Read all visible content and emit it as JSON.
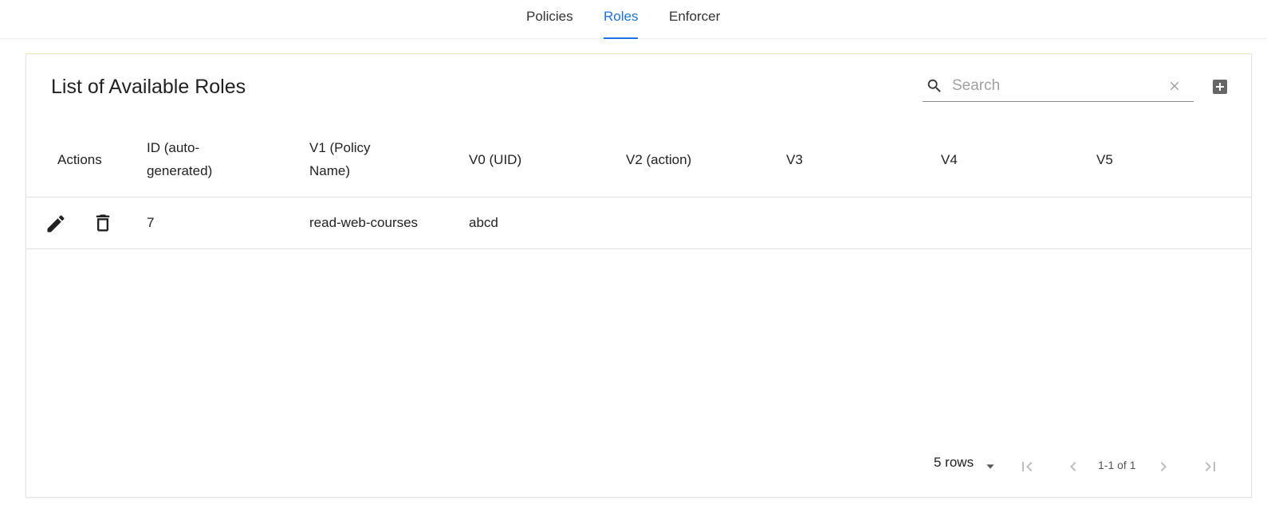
{
  "tabs": [
    {
      "label": "Policies",
      "active": false
    },
    {
      "label": "Roles",
      "active": true
    },
    {
      "label": "Enforcer",
      "active": false
    }
  ],
  "card": {
    "title": "List of Available Roles",
    "search": {
      "placeholder": "Search",
      "value": ""
    }
  },
  "table": {
    "columns": [
      "Actions",
      "ID (auto-generated)",
      "V1 (Policy Name)",
      "V0 (UID)",
      "V2 (action)",
      "V3",
      "V4",
      "V5"
    ],
    "rows": [
      {
        "id": "7",
        "v1": "read-web-courses",
        "v0": "abcd",
        "v2": "",
        "v3": "",
        "v4": "",
        "v5": ""
      }
    ]
  },
  "pagination": {
    "rows_label": "5 rows",
    "range_text": "1-1 of 1"
  },
  "colors": {
    "accent": "#1a73e8",
    "text": "#212121",
    "border": "#e0e0e0"
  },
  "icons": [
    "search-icon",
    "clear-icon",
    "add-box-icon",
    "edit-icon",
    "delete-icon",
    "dropdown-caret-icon",
    "first-page-icon",
    "previous-page-icon",
    "next-page-icon",
    "last-page-icon"
  ]
}
